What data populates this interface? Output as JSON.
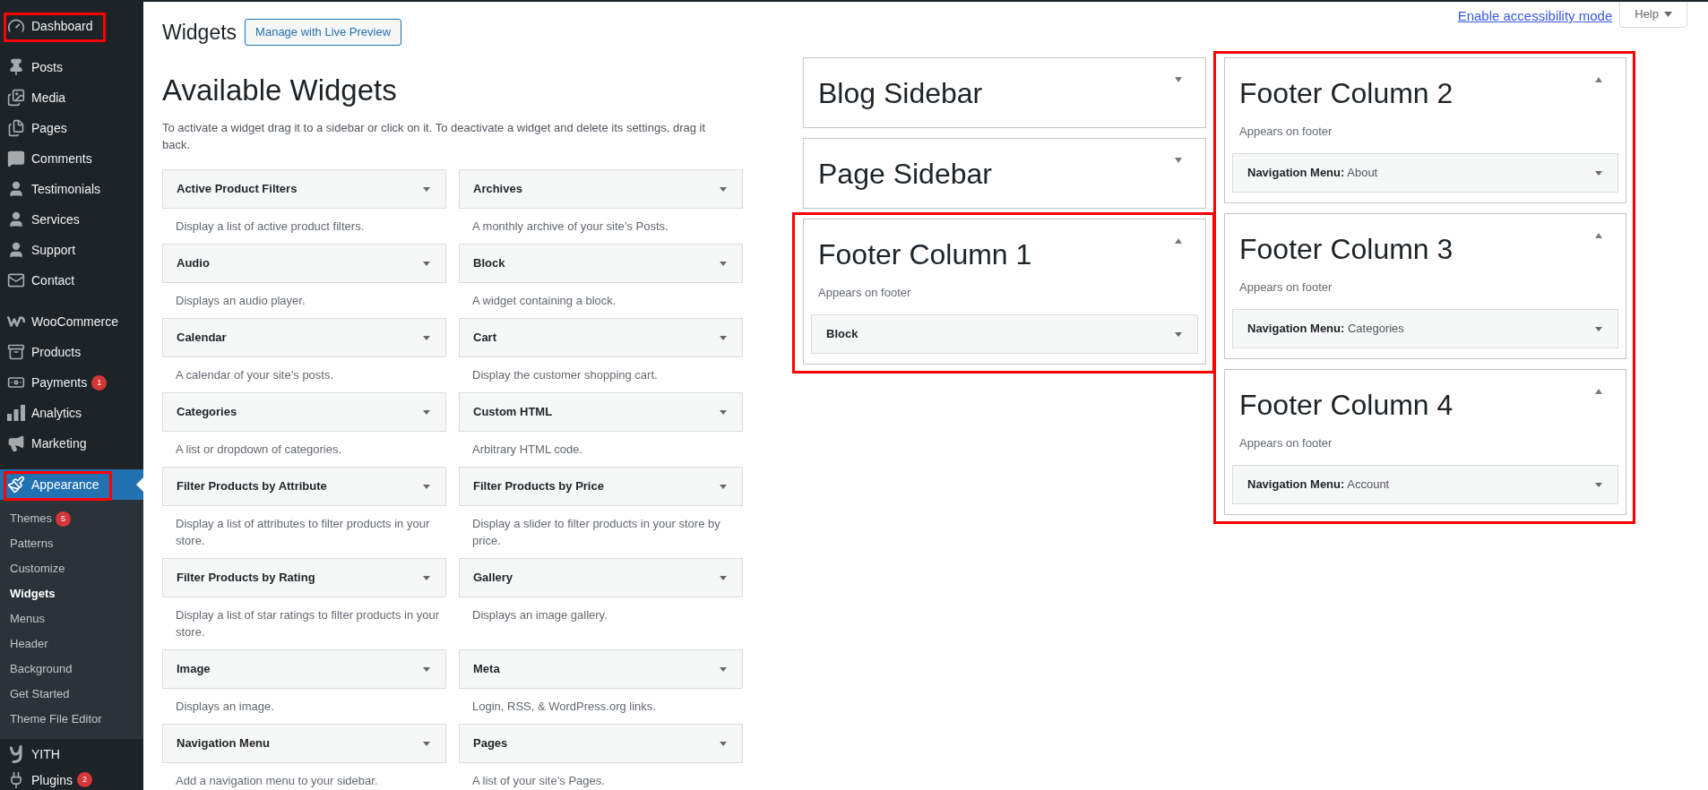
{
  "admin_menu": [
    {
      "items": [
        {
          "label": "Dashboard",
          "selected": false,
          "highlighted": true
        }
      ]
    },
    {
      "items": [
        {
          "label": "Posts",
          "selected": false,
          "highlighted": false
        },
        {
          "label": "Media",
          "selected": false,
          "highlighted": false
        },
        {
          "label": "Pages",
          "selected": false,
          "highlighted": false
        },
        {
          "label": "Comments",
          "selected": false,
          "highlighted": false
        },
        {
          "label": "Testimonials",
          "selected": false,
          "highlighted": false
        },
        {
          "label": "Services",
          "selected": false,
          "highlighted": false
        },
        {
          "label": "Support",
          "selected": false,
          "highlighted": false
        },
        {
          "label": "Contact",
          "selected": false,
          "highlighted": false
        }
      ]
    },
    {
      "items": [
        {
          "label": "WooCommerce",
          "selected": false,
          "highlighted": false
        },
        {
          "label": "Products",
          "selected": false,
          "highlighted": false
        },
        {
          "label": "Payments",
          "badge": "1",
          "selected": false,
          "highlighted": false
        },
        {
          "label": "Analytics",
          "selected": false,
          "highlighted": false
        },
        {
          "label": "Marketing",
          "selected": false,
          "highlighted": false
        }
      ]
    },
    {
      "items": [
        {
          "label": "Appearance",
          "selected": true,
          "highlighted": true,
          "children": [
            {
              "label": "Themes",
              "badge": "5",
              "selected": false
            },
            {
              "label": "Patterns",
              "selected": false
            },
            {
              "label": "Customize",
              "selected": false
            },
            {
              "label": "Widgets",
              "selected": true
            },
            {
              "label": "Menus",
              "selected": false
            },
            {
              "label": "Header",
              "selected": false
            },
            {
              "label": "Background",
              "selected": false
            },
            {
              "label": "Get Started",
              "selected": false
            },
            {
              "label": "Theme File Editor",
              "selected": false
            }
          ]
        },
        {
          "label": "YITH",
          "selected": false,
          "highlighted": false
        },
        {
          "label": "Plugins",
          "badge": "2",
          "selected": false,
          "highlighted": false
        }
      ]
    }
  ],
  "header": {
    "title": "Widgets",
    "live_preview_button": "Manage with Live Preview"
  },
  "screen_meta": {
    "accessibility_link": "Enable accessibility mode",
    "help_button": "Help"
  },
  "available_widgets": {
    "title": "Available Widgets",
    "description": "To activate a widget drag it to a sidebar or click on it. To deactivate a widget and delete its settings, drag it back.",
    "widgets": [
      {
        "title": "Active Product Filters",
        "description": "Display a list of active product filters."
      },
      {
        "title": "Archives",
        "description": "A monthly archive of your site’s Posts."
      },
      {
        "title": "Audio",
        "description": "Displays an audio player."
      },
      {
        "title": "Block",
        "description": "A widget containing a block."
      },
      {
        "title": "Calendar",
        "description": "A calendar of your site’s posts."
      },
      {
        "title": "Cart",
        "description": "Display the customer shopping cart."
      },
      {
        "title": "Categories",
        "description": "A list or dropdown of categories."
      },
      {
        "title": "Custom HTML",
        "description": "Arbitrary HTML code."
      },
      {
        "title": "Filter Products by Attribute",
        "description": "Display a list of attributes to filter products in your store."
      },
      {
        "title": "Filter Products by Price",
        "description": "Display a slider to filter products in your store by price."
      },
      {
        "title": "Filter Products by Rating",
        "description": "Display a list of star ratings to filter products in your store."
      },
      {
        "title": "Gallery",
        "description": "Displays an image gallery."
      },
      {
        "title": "Image",
        "description": "Displays an image."
      },
      {
        "title": "Meta",
        "description": "Login, RSS, & WordPress.org links."
      },
      {
        "title": "Navigation Menu",
        "description": "Add a navigation menu to your sidebar."
      },
      {
        "title": "Pages",
        "description": "A list of your site’s Pages."
      }
    ]
  },
  "sidebar_columns": [
    {
      "sidebars": [
        {
          "title": "Blog Sidebar",
          "expanded": false,
          "highlighted": false
        },
        {
          "title": "Page Sidebar",
          "expanded": false,
          "highlighted": false
        },
        {
          "title": "Footer Column 1",
          "expanded": true,
          "highlighted": true,
          "description": "Appears on footer",
          "widgets": [
            {
              "title": "Block"
            }
          ]
        }
      ]
    },
    {
      "sidebars": [
        {
          "title": "Footer Column 2",
          "expanded": true,
          "highlighted": true,
          "description": "Appears on footer",
          "widgets": [
            {
              "title": "Navigation Menu:",
              "instance_title": "About"
            }
          ]
        },
        {
          "title": "Footer Column 3",
          "expanded": true,
          "highlighted": true,
          "description": "Appears on footer",
          "widgets": [
            {
              "title": "Navigation Menu:",
              "instance_title": "Categories"
            }
          ]
        },
        {
          "title": "Footer Column 4",
          "expanded": true,
          "highlighted": true,
          "description": "Appears on footer",
          "widgets": [
            {
              "title": "Navigation Menu:",
              "instance_title": "Account"
            }
          ]
        }
      ]
    }
  ]
}
